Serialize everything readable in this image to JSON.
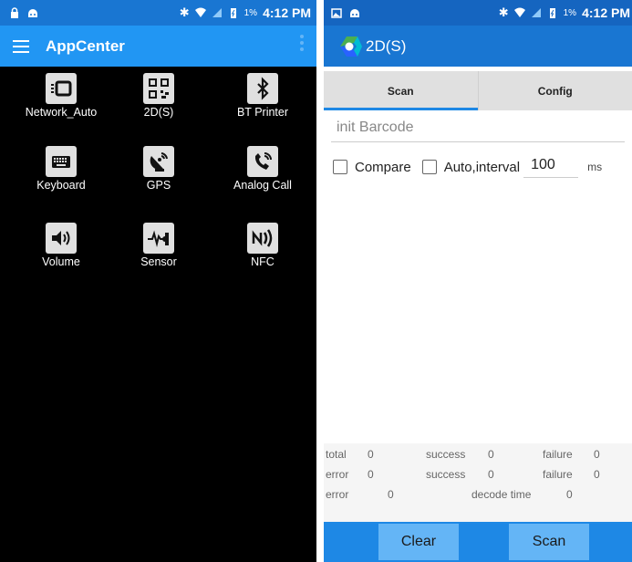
{
  "left": {
    "status": {
      "battery": "1%",
      "time": "4:12 PM"
    },
    "appbar": {
      "title": "AppCenter"
    },
    "apps": [
      {
        "label": "Network_Auto",
        "icon": "network-icon"
      },
      {
        "label": "2D(S)",
        "icon": "qr-code-icon"
      },
      {
        "label": "BT Printer",
        "icon": "bluetooth-icon"
      },
      {
        "label": "Keyboard",
        "icon": "keyboard-icon"
      },
      {
        "label": "GPS",
        "icon": "satellite-icon"
      },
      {
        "label": "Analog Call",
        "icon": "phone-call-icon"
      },
      {
        "label": "Volume",
        "icon": "volume-icon"
      },
      {
        "label": "Sensor",
        "icon": "sensor-icon"
      },
      {
        "label": "NFC",
        "icon": "nfc-icon"
      }
    ]
  },
  "right": {
    "status": {
      "battery": "1%",
      "time": "4:12 PM"
    },
    "appbar": {
      "title": "2D(S)"
    },
    "tabs": [
      {
        "label": "Scan"
      },
      {
        "label": "Config"
      }
    ],
    "barcode_placeholder": "init Barcode",
    "compare_label": "Compare",
    "auto_label": "Auto,interval",
    "interval_value": "100",
    "interval_unit": "ms",
    "stats": {
      "total_label": "total",
      "total_value": "0",
      "success_label": "success",
      "success_value": "0",
      "failure_label": "failure",
      "failure_value": "0",
      "error_label": "error",
      "error_value": "0",
      "success2_label": "success",
      "success2_value": "0",
      "failure2_label": "failure",
      "failure2_value": "0",
      "error2_label": "error",
      "error2_value": "0",
      "decode_label": "decode time",
      "decode_value": "0"
    },
    "buttons": {
      "clear": "Clear",
      "scan": "Scan"
    }
  },
  "colors": {
    "status_bar": "#1565c0",
    "app_bar": "#1976d2",
    "accent": "#1e88e5",
    "button": "#64b5f6"
  }
}
